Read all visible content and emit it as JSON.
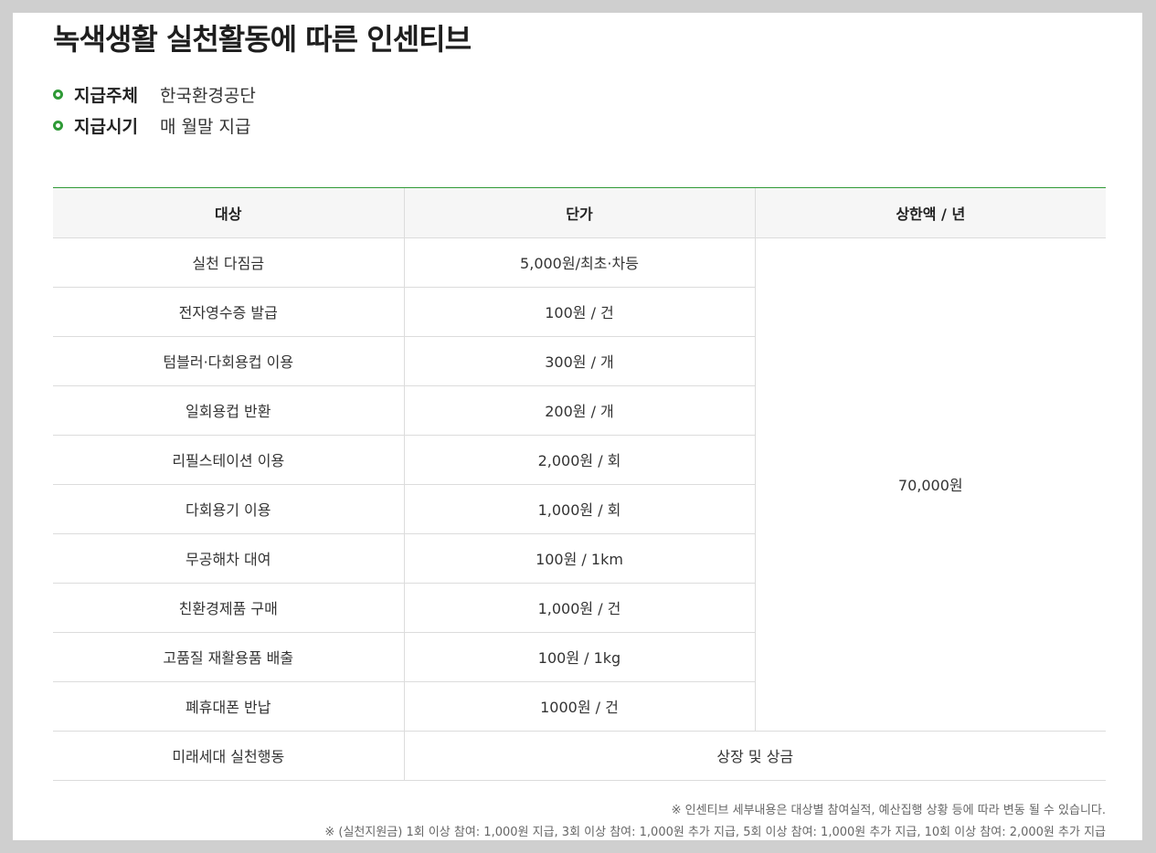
{
  "title": "녹색생활 실천활동에 따른 인센티브",
  "info": [
    {
      "label": "지급주체",
      "value": "한국환경공단"
    },
    {
      "label": "지급시기",
      "value": "매 월말 지급"
    }
  ],
  "table": {
    "headers": [
      "대상",
      "단가",
      "상한액 / 년"
    ],
    "rows": [
      {
        "target": "실천 다짐금",
        "price": "5,000원/최초·차등"
      },
      {
        "target": "전자영수증 발급",
        "price": "100원 / 건"
      },
      {
        "target": "텀블러·다회용컵 이용",
        "price": "300원 / 개"
      },
      {
        "target": "일회용컵 반환",
        "price": "200원 / 개"
      },
      {
        "target": "리필스테이션 이용",
        "price": "2,000원 / 회"
      },
      {
        "target": "다회용기 이용",
        "price": "1,000원 / 회"
      },
      {
        "target": "무공해차 대여",
        "price": "100원 / 1km"
      },
      {
        "target": "친환경제품 구매",
        "price": "1,000원 / 건"
      },
      {
        "target": "고품질 재활용품 배출",
        "price": "100원 / 1kg"
      },
      {
        "target": "폐휴대폰 반납",
        "price": "1000원 / 건"
      }
    ],
    "cap": "70,000원",
    "last_row": {
      "target": "미래세대 실천행동",
      "reward": "상장 및 상금"
    }
  },
  "notes": [
    "※ 인센티브 세부내용은 대상별 참여실적, 예산집행 상황 등에 따라 변동 될 수 있습니다.",
    "※ (실천지원금) 1회 이상 참여: 1,000원 지급, 3회 이상 참여: 1,000원 추가 지급, 5회 이상 참여: 1,000원 추가 지급, 10회 이상 참여: 2,000원 추가 지급"
  ],
  "colors": {
    "accent": "#2f9a37",
    "header_bg": "#f6f6f6",
    "border": "#dcdcdc"
  }
}
